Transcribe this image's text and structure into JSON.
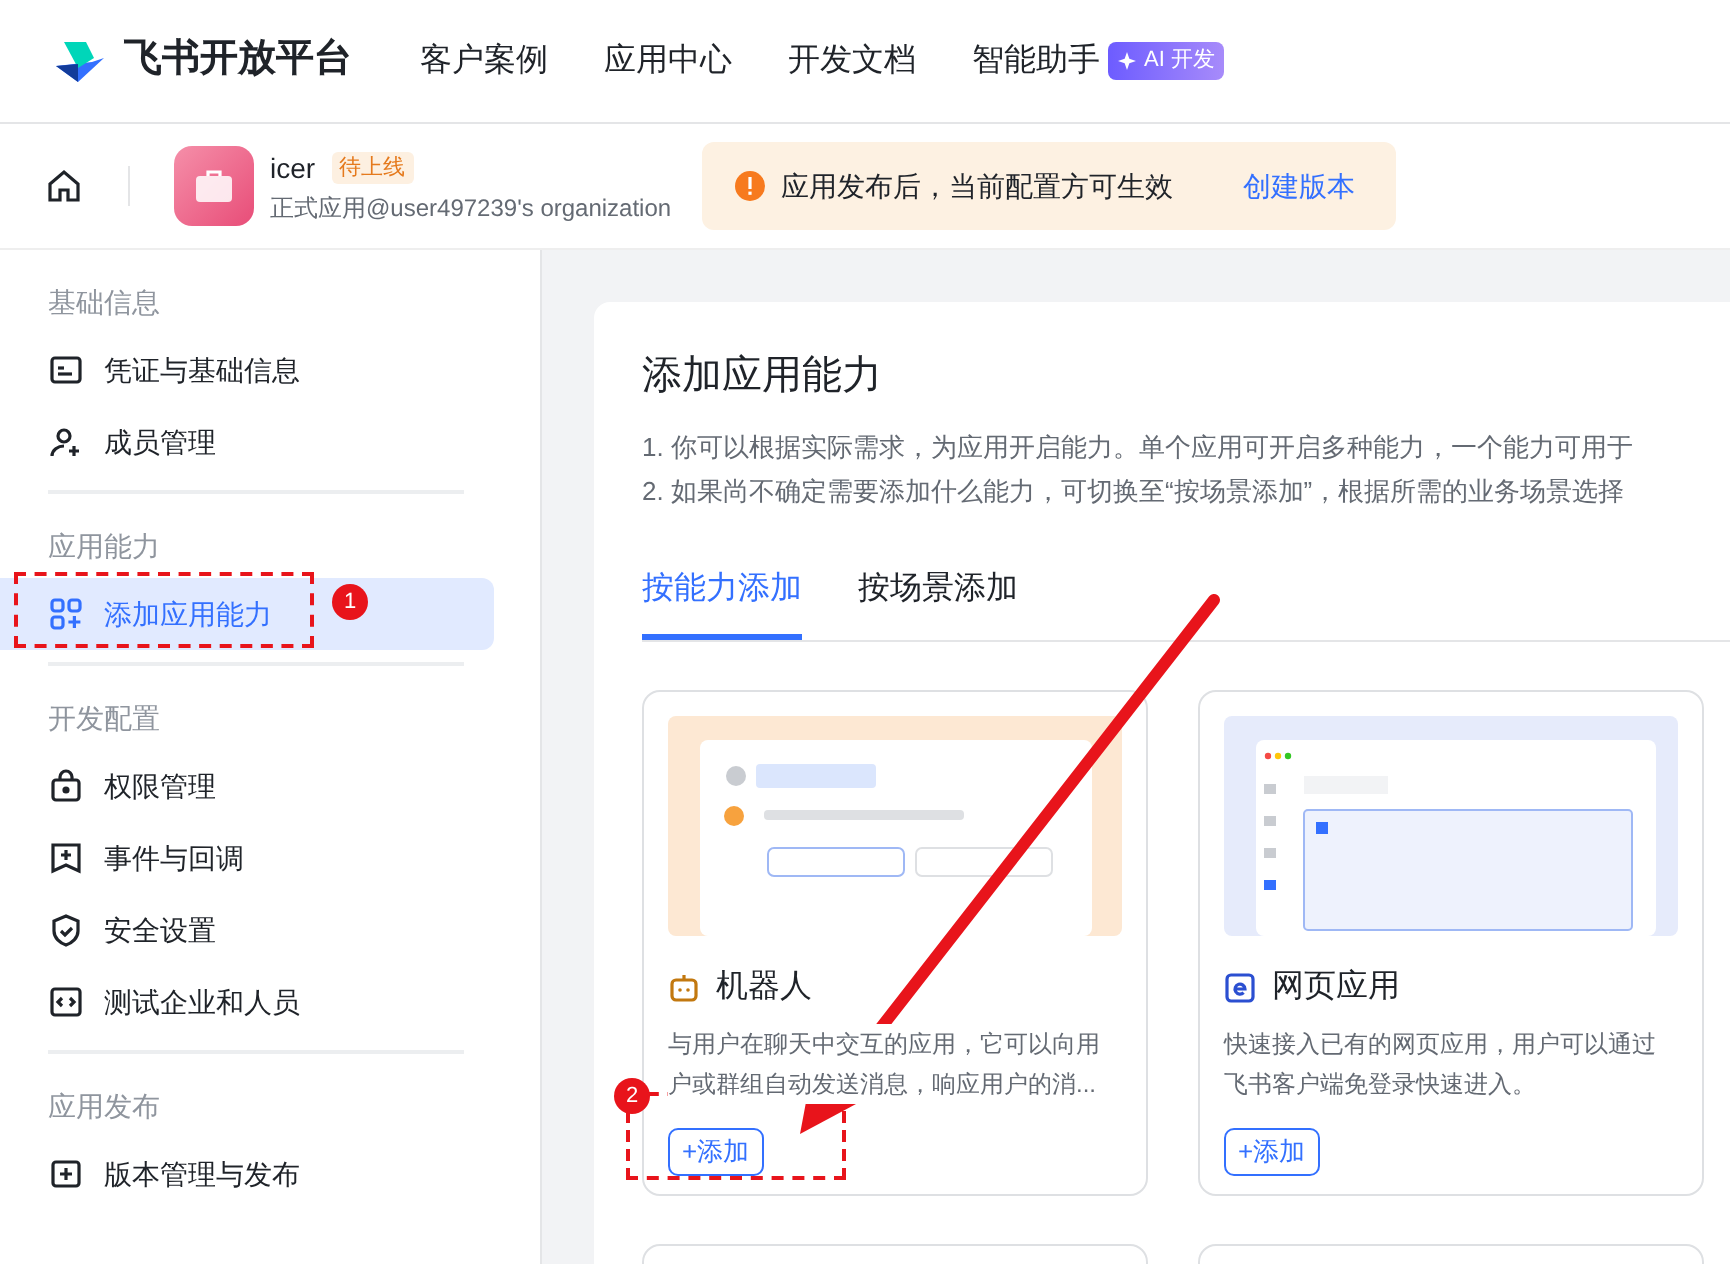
{
  "header": {
    "logo": "飞书开放平台",
    "nav": [
      {
        "label": "客户案例"
      },
      {
        "label": "应用中心"
      },
      {
        "label": "开发文档"
      },
      {
        "label": "智能助手",
        "badge": "AI 开发"
      }
    ]
  },
  "app_bar": {
    "app_name": "icer",
    "status": "待上线",
    "subtitle": "正式应用@user497239's organization",
    "notice": "应用发布后，当前配置方可生效",
    "notice_link": "创建版本"
  },
  "sidebar": {
    "sections": [
      {
        "title": "基础信息",
        "items": [
          {
            "label": "凭证与基础信息",
            "selected": false
          },
          {
            "label": "成员管理",
            "selected": false
          }
        ]
      },
      {
        "title": "应用能力",
        "items": [
          {
            "label": "添加应用能力",
            "selected": true
          }
        ]
      },
      {
        "title": "开发配置",
        "items": [
          {
            "label": "权限管理",
            "selected": false
          },
          {
            "label": "事件与回调",
            "selected": false
          },
          {
            "label": "安全设置",
            "selected": false
          },
          {
            "label": "测试企业和人员",
            "selected": false
          }
        ]
      },
      {
        "title": "应用发布",
        "items": [
          {
            "label": "版本管理与发布",
            "selected": false
          }
        ]
      }
    ]
  },
  "main": {
    "title": "添加应用能力",
    "notes": [
      "1. 你可以根据实际需求，为应用开启能力。单个应用可开启多种能力，一个能力可用于",
      "2. 如果尚不确定需要添加什么能力，可切换至“按场景添加”，根据所需的业务场景选择"
    ],
    "tabs": [
      {
        "label": "按能力添加",
        "selected": true
      },
      {
        "label": "按场景添加",
        "selected": false
      }
    ],
    "cards": [
      {
        "kind": "bot",
        "title": "机器人",
        "description": "与用户在聊天中交互的应用，它可以向用户或群组自动发送消息，响应用户的消...",
        "button": "+添加"
      },
      {
        "kind": "web",
        "title": "网页应用",
        "description": "快速接入已有的网页应用，用户可以通过飞书客户端免登录快速进入。",
        "button": "+添加"
      }
    ]
  },
  "annotations": [
    {
      "label": "1"
    },
    {
      "label": "2"
    }
  ]
}
